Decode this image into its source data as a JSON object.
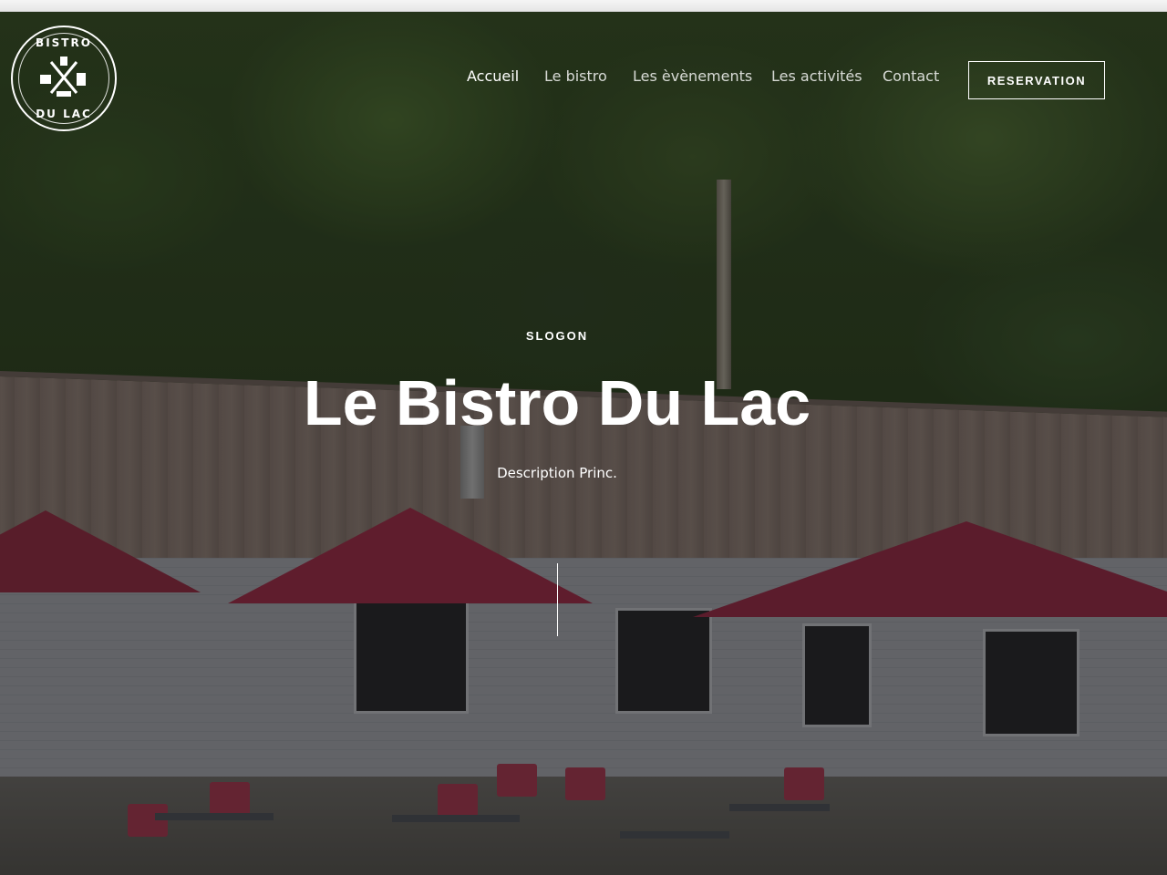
{
  "logo": {
    "top_text": "BISTRO",
    "bottom_text": "DU LAC"
  },
  "nav": {
    "items": [
      {
        "label": "Accueil",
        "active": true
      },
      {
        "label": "Le bistro"
      },
      {
        "label": "Les èvènements"
      },
      {
        "label": "Les activités"
      },
      {
        "label": "Contact"
      }
    ],
    "cta_label": "RESERVATION"
  },
  "hero": {
    "slogan": "SLOGON",
    "title": "Le Bistro Du Lac",
    "description": "Description Princ.",
    "background_image": "restaurant-terrace-photo"
  },
  "colors": {
    "text": "#ffffff",
    "overlay": "rgba(0,0,0,0.38)",
    "umbrella": "#8f2f45"
  }
}
